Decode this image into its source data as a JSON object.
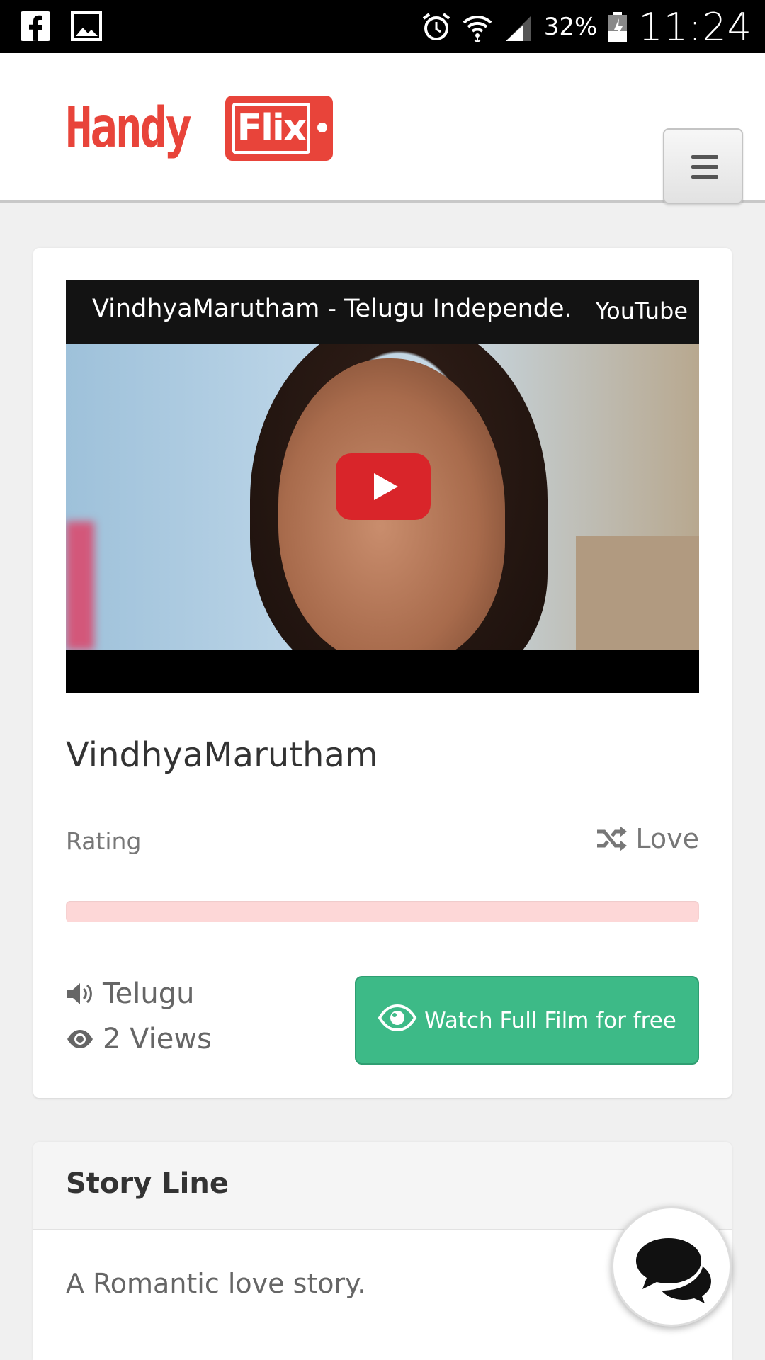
{
  "status_bar": {
    "left_icons": [
      "facebook-icon",
      "image-icon"
    ],
    "right_icons": [
      "alarm-icon",
      "wifi-icon",
      "signal-icon",
      "battery-icon"
    ],
    "battery": "32%",
    "time": "11:24"
  },
  "navbar": {
    "logo_left": "Handy",
    "logo_right": "Flix",
    "brand_color": "#e8443a"
  },
  "video": {
    "title": "VindhyaMarutham - Telugu Independe...",
    "provider": "YouTube",
    "play_color": "#d9252a"
  },
  "film": {
    "title": "VindhyaMarutham",
    "rating_label": "Rating",
    "rating_fraction": 0,
    "genre": "Love",
    "language": "Telugu",
    "views": "2 Views",
    "watch_label": "Watch Full Film for free",
    "watch_color": "#3dba87"
  },
  "story": {
    "heading": "Story Line",
    "text": "A Romantic love story."
  },
  "chat": {
    "icon": "chat-bubbles-icon"
  }
}
